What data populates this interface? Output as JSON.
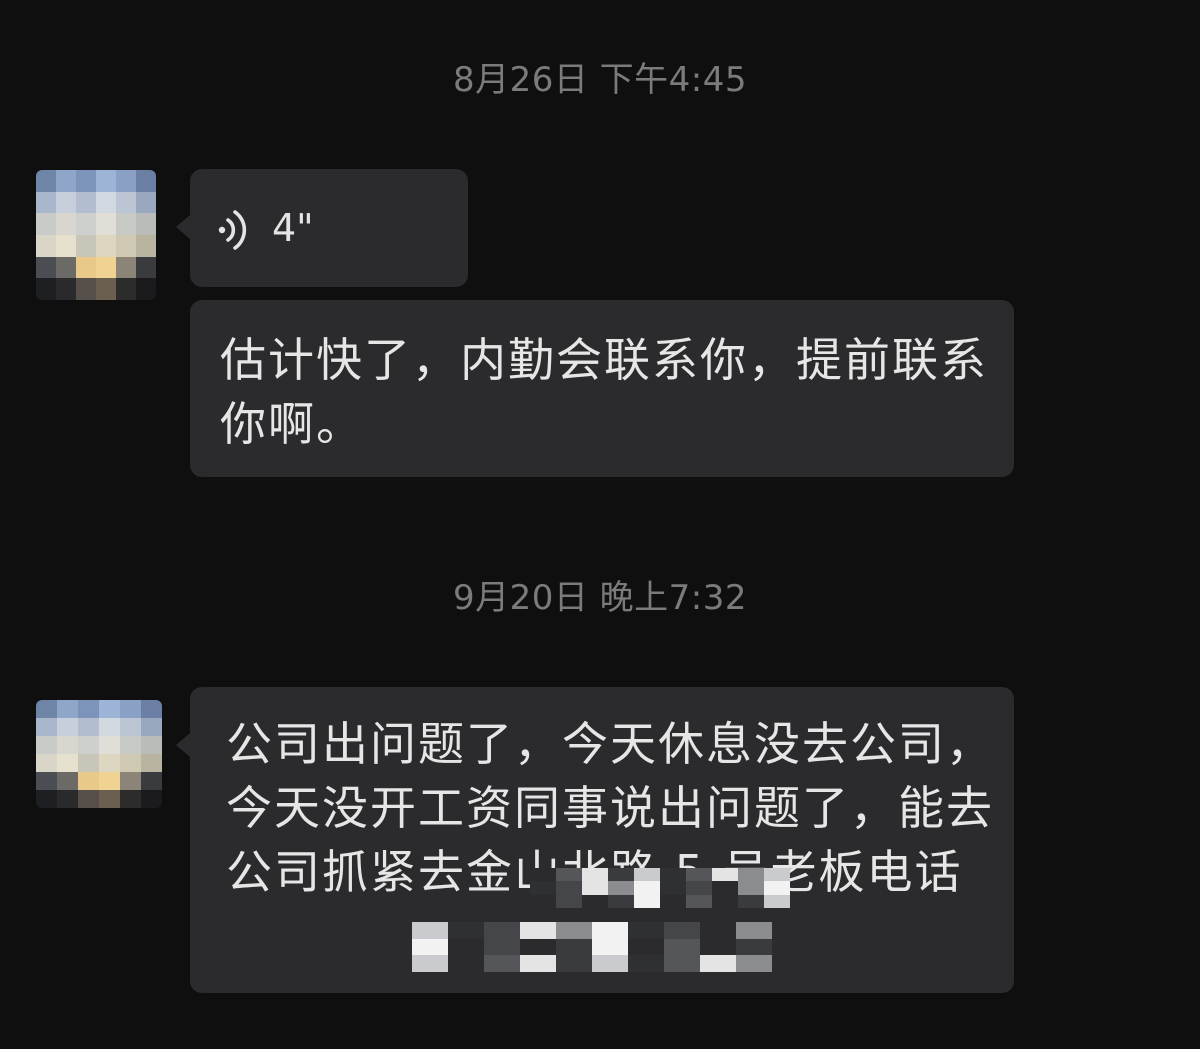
{
  "chat": {
    "messages": [
      {
        "timestamp": "8月26日 下午4:45",
        "voice": {
          "duration": "4\""
        },
        "text": "估计快了，内勤会联系你，提前联系你啊。"
      },
      {
        "timestamp": "9月20日 晚上7:32",
        "text": "公司出问题了，今天休息没去公司，今天没开工资同事说出问题了，能去公司抓紧去金山北路 5 号老板电话"
      }
    ]
  },
  "colors": {
    "background": "#0f0f10",
    "bubble": "#2b2b2d",
    "timestamp_text": "#7b7b7e",
    "message_text": "#e6e6e6"
  },
  "icons": {
    "voice": "voice-wave-icon"
  }
}
